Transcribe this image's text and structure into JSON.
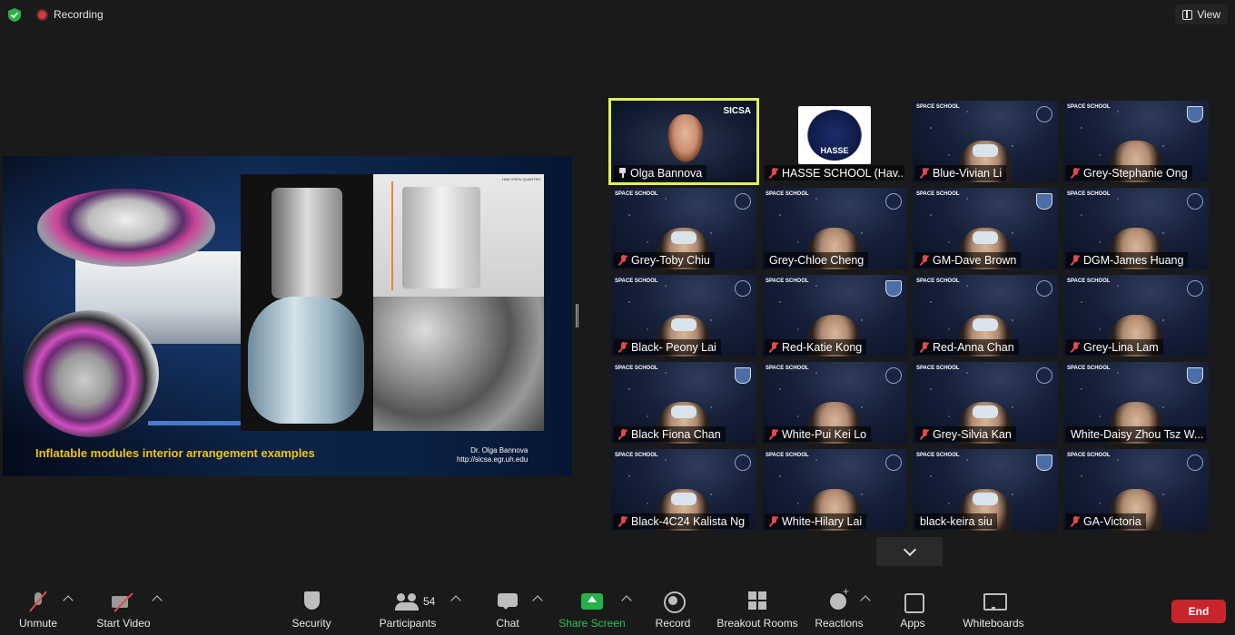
{
  "top": {
    "recording_label": "Recording",
    "view_label": "View"
  },
  "shared_slide": {
    "title": "Inflatable modules interior arrangement examples",
    "credit_line1": "Dr. Olga Bannova",
    "credit_line2": "http://sicsa.egr.uh.edu",
    "panel_label": "HAB CREW QUARTER"
  },
  "gallery": {
    "presenter_watermark": "SICSA",
    "hasse_logo_text": "HASSE",
    "tile_logo_text": "SPACE SCHOOL",
    "participants": [
      {
        "name": "Olga Bannova",
        "muted": false,
        "pinned": true,
        "active": true
      },
      {
        "name": "HASSE SCHOOL (Hav...",
        "muted": true
      },
      {
        "name": "Blue-Vivian Li",
        "muted": true
      },
      {
        "name": "Grey-Stephanie Ong",
        "muted": true
      },
      {
        "name": "Grey-Toby Chiu",
        "muted": true
      },
      {
        "name": "Grey-Chloe Cheng",
        "muted": false
      },
      {
        "name": "GM-Dave Brown",
        "muted": true
      },
      {
        "name": "DGM-James Huang",
        "muted": true
      },
      {
        "name": "Black- Peony Lai",
        "muted": true
      },
      {
        "name": "Red-Katie Kong",
        "muted": true
      },
      {
        "name": "Red-Anna Chan",
        "muted": true
      },
      {
        "name": "Grey-Lina Lam",
        "muted": true
      },
      {
        "name": "Black Fiona Chan",
        "muted": true
      },
      {
        "name": "White-Pui Kei Lo",
        "muted": true
      },
      {
        "name": "Grey-Silvia Kan",
        "muted": true
      },
      {
        "name": "White-Daisy Zhou Tsz W...",
        "muted": false
      },
      {
        "name": "Black-4C24 Kalista Ng",
        "muted": true
      },
      {
        "name": "White-Hilary Lai",
        "muted": true
      },
      {
        "name": "black-keira siu",
        "muted": false
      },
      {
        "name": "GA-Victoria",
        "muted": true
      }
    ]
  },
  "toolbar": {
    "unmute": "Unmute",
    "start_video": "Start Video",
    "security": "Security",
    "participants": "Participants",
    "participants_count": "54",
    "chat": "Chat",
    "share_screen": "Share Screen",
    "record": "Record",
    "breakout_rooms": "Breakout Rooms",
    "reactions": "Reactions",
    "apps": "Apps",
    "whiteboards": "Whiteboards",
    "end": "End"
  },
  "colors": {
    "active_speaker": "#e2f05a",
    "share_green": "#24b24a",
    "end_red": "#c8242c",
    "slide_title": "#f0c419"
  }
}
